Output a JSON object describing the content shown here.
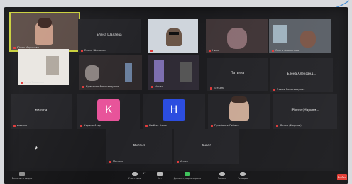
{
  "participants": {
    "tile_1": "Юлия Марычева",
    "tile_2_center": "Елена Шалаева",
    "tile_2": "Елена Шалаева",
    "tile_3": "Диана Литвинова",
    "tile_4": "Ника",
    "tile_5": "Ольга Агафонова",
    "tile_6": "Анна Тарасова",
    "tile_7": "Кристина Александрова",
    "tile_8": "Нисия",
    "tile_9": "Татьяна",
    "tile_9_center": "Татьяна",
    "tile_10_center": "Елена Александ...",
    "tile_10": "Елена Александрова",
    "tile_11_center": "милена",
    "tile_11": "милена",
    "tile_12_letter": "К",
    "tile_12": "Карина Азар",
    "tile_13_letter": "Н",
    "tile_13": "Нейбаг Алина",
    "tile_14": "Гусейнова Сабина",
    "tile_15_center": "iPhone (Марьям...",
    "tile_15": "iPhone (Марьям)",
    "tile_16_center": "Милана",
    "tile_16": "Милана",
    "tile_17_center": "Ангел",
    "tile_17": "Ангел"
  },
  "toolbar": {
    "video": "Включить видео",
    "participants": "Участники",
    "participants_count": "17",
    "chat": "Чат",
    "share": "Демонстрация экрана",
    "record": "Запись",
    "reactions": "Реакции",
    "end": "Выйти"
  },
  "colors": {
    "active_border": "#c9d03a",
    "k_avatar": "#e8539a",
    "n_avatar": "#2a4ce0",
    "share_green": "#3cc25a",
    "end_red": "#e33a30"
  }
}
